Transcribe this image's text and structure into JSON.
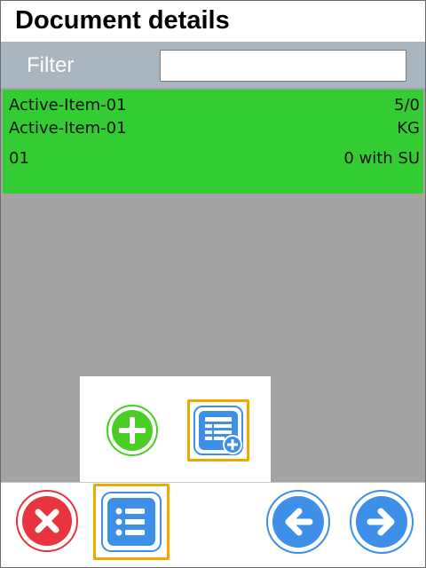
{
  "header": {
    "title": "Document details"
  },
  "filter": {
    "label": "Filter",
    "value": "",
    "placeholder": ""
  },
  "list": {
    "items": [
      {
        "line1_left": "Active-Item-01",
        "line1_right": "5/0",
        "line2_left": "Active-Item-01",
        "line2_right": "KG",
        "line3_left": "01",
        "line3_right": "0 with SU"
      }
    ]
  },
  "popup": {
    "buttons": [
      {
        "icon": "plus-circle-icon"
      },
      {
        "icon": "add-document-icon"
      }
    ]
  },
  "toolbar": {
    "buttons": [
      {
        "icon": "close-circle-icon"
      },
      {
        "icon": "list-icon"
      },
      {
        "icon": "arrow-left-icon"
      },
      {
        "icon": "arrow-right-icon"
      }
    ]
  },
  "colors": {
    "header_bg": "#ffffff",
    "filter_bar_bg": "#a9b5bf",
    "list_bg": "#a3a3a3",
    "item_bg": "#33cc33",
    "focus_border": "#f0a800",
    "cancel_red": "#e8343f",
    "nav_blue": "#3d8fe8",
    "add_green": "#4ccd25"
  }
}
